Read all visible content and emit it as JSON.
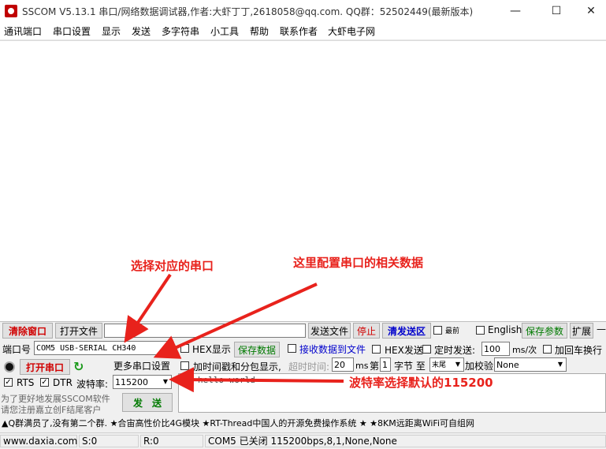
{
  "window": {
    "title": "SSCOM V5.13.1 串口/网络数据调试器,作者:大虾丁丁,2618058@qq.com. QQ群：52502449(最新版本)",
    "minimize_glyph": "—",
    "maximize_glyph": "☐",
    "close_glyph": "✕"
  },
  "menu": {
    "items": [
      "通讯端口",
      "串口设置",
      "显示",
      "发送",
      "多字符串",
      "小工具",
      "帮助",
      "联系作者",
      "大虾电子网"
    ]
  },
  "toolbar": {
    "clear_window": "清除窗口",
    "open_file": "打开文件",
    "file_path": "",
    "send_file": "发送文件",
    "stop": "停止",
    "clear_send_area": "清发送区",
    "topmost_label": "最前",
    "english_label": "English",
    "save_params": "保存参数",
    "expand": "扩展",
    "dash": "—"
  },
  "port_panel": {
    "port_label": "端口号",
    "port_value": "COM5 USB-SERIAL CH340",
    "open_port": "打开串口",
    "more_settings": "更多串口设置",
    "rts_label": "RTS",
    "dtr_label": "DTR",
    "baud_label": "波特率:",
    "baud_value": "115200",
    "promo_line1": "为了更好地发展SSCOM软件",
    "promo_line2": "请您注册嘉立创F结尾客户",
    "send_button": "发　送",
    "rts_checked": true,
    "dtr_checked": true
  },
  "options": {
    "hex_display": "HEX显示",
    "save_data": "保存数据",
    "recv_to_file": "接收数据到文件",
    "hex_send": "HEX发送",
    "timed_send": "定时发送:",
    "timed_value": "100",
    "ms_per": "ms/次",
    "add_crlf": "加回车换行",
    "timestamp": "加时间戳和分包显示,",
    "timeout_label": "超时时间:",
    "timeout_value": "20",
    "ms": "ms",
    "nth_label": "第",
    "nth_value": "1",
    "byte_to": "字节  至",
    "end_value": "末尾",
    "checksum_label": "加校验",
    "checksum_value": "None",
    "send_text": "hello world"
  },
  "ad_bar": "▲Q群满员了,没有第二个群. ★合宙高性价比4G模块 ★RT-Thread中国人的开源免费操作系统 ★ ★8KM远距离WiFi可自组网",
  "status": {
    "website": "www.daxia.com",
    "sent": "S:0",
    "received": "R:0",
    "port_status": "COM5 已关闭  115200bps,8,1,None,None"
  },
  "annotations": {
    "select_port": "选择对应的串口",
    "config_params": "这里配置串口的相关数据",
    "baud_default": "波特率选择默认的115200"
  },
  "colors": {
    "annotation_red": "#e8221c",
    "clear_button_text": "#d00000",
    "save_button_text": "#007a00"
  }
}
